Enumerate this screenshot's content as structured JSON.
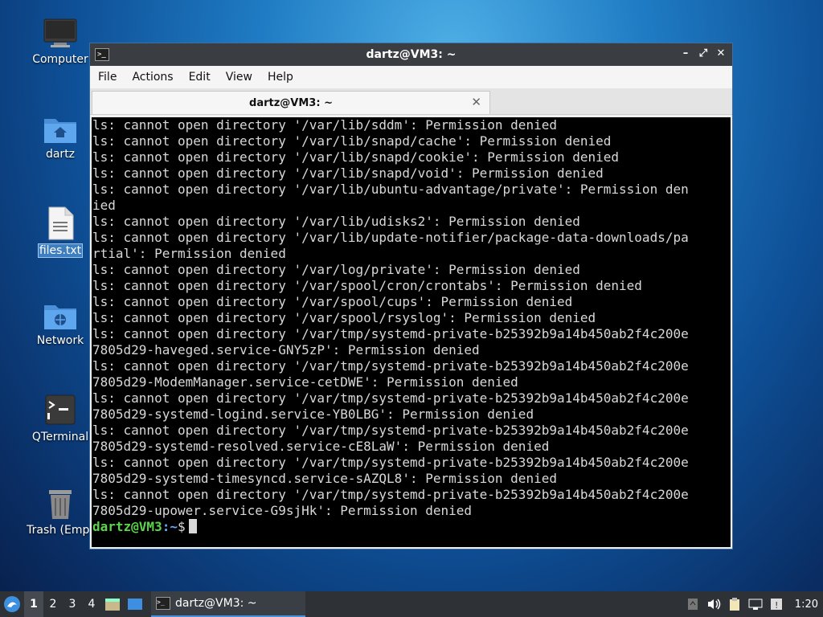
{
  "desktop": {
    "icons": [
      {
        "name": "Computer",
        "icon": "monitor-icon"
      },
      {
        "name": "dartz",
        "icon": "home-folder-icon"
      },
      {
        "name": "files.txt",
        "icon": "text-file-icon"
      },
      {
        "name": "Network",
        "icon": "network-folder-icon"
      },
      {
        "name": "QTerminal",
        "icon": "terminal-icon"
      },
      {
        "name": "Trash (Empt",
        "icon": "trash-icon"
      }
    ]
  },
  "window": {
    "title": "dartz@VM3: ~",
    "menu": [
      "File",
      "Actions",
      "Edit",
      "View",
      "Help"
    ],
    "tab_label": "dartz@VM3: ~",
    "terminal_lines": [
      "ls: cannot open directory '/var/lib/sddm': Permission denied",
      "ls: cannot open directory '/var/lib/snapd/cache': Permission denied",
      "ls: cannot open directory '/var/lib/snapd/cookie': Permission denied",
      "ls: cannot open directory '/var/lib/snapd/void': Permission denied",
      "ls: cannot open directory '/var/lib/ubuntu-advantage/private': Permission den",
      "ied",
      "ls: cannot open directory '/var/lib/udisks2': Permission denied",
      "ls: cannot open directory '/var/lib/update-notifier/package-data-downloads/pa",
      "rtial': Permission denied",
      "ls: cannot open directory '/var/log/private': Permission denied",
      "ls: cannot open directory '/var/spool/cron/crontabs': Permission denied",
      "ls: cannot open directory '/var/spool/cups': Permission denied",
      "ls: cannot open directory '/var/spool/rsyslog': Permission denied",
      "ls: cannot open directory '/var/tmp/systemd-private-b25392b9a14b450ab2f4c200e",
      "7805d29-haveged.service-GNY5zP': Permission denied",
      "ls: cannot open directory '/var/tmp/systemd-private-b25392b9a14b450ab2f4c200e",
      "7805d29-ModemManager.service-cetDWE': Permission denied",
      "ls: cannot open directory '/var/tmp/systemd-private-b25392b9a14b450ab2f4c200e",
      "7805d29-systemd-logind.service-YB0LBG': Permission denied",
      "ls: cannot open directory '/var/tmp/systemd-private-b25392b9a14b450ab2f4c200e",
      "7805d29-systemd-resolved.service-cE8LaW': Permission denied",
      "ls: cannot open directory '/var/tmp/systemd-private-b25392b9a14b450ab2f4c200e",
      "7805d29-systemd-timesyncd.service-sAZQL8': Permission denied",
      "ls: cannot open directory '/var/tmp/systemd-private-b25392b9a14b450ab2f4c200e",
      "7805d29-upower.service-G9sjHk': Permission denied"
    ],
    "prompt": {
      "user_host": "dartz@VM3",
      "sep": ":",
      "path": "~",
      "symbol": "$"
    }
  },
  "taskbar": {
    "workspaces": [
      "1",
      "2",
      "3",
      "4"
    ],
    "active_workspace": "1",
    "task_label": "dartz@VM3: ~",
    "clock": "1:20"
  }
}
